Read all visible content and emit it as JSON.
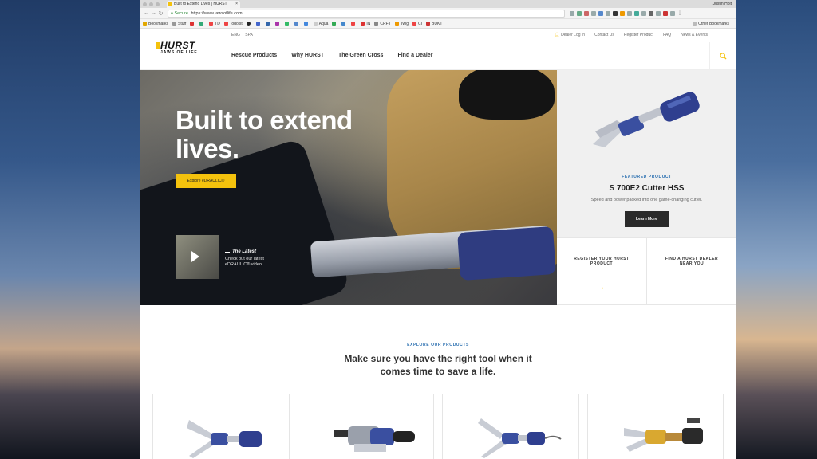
{
  "browser": {
    "tab_title": "Built to Extend Lives | HURST",
    "user": "Justin Holt",
    "secure_label": "Secure",
    "url": "https://www.jawsoflife.com",
    "bookmarks": [
      "Bookmarks",
      "Stuff",
      "TD",
      "Todoist",
      "Aqua",
      "IN",
      "CRFT",
      "Twig",
      "CI",
      "BUKT"
    ],
    "other_bookmarks": "Other Bookmarks"
  },
  "site": {
    "logo_main": "HURST",
    "logo_sub": "JAWS OF LIFE",
    "lang": [
      "ENG",
      "SPA"
    ],
    "utility": [
      "Dealer Log In",
      "Contact Us",
      "Register Product",
      "FAQ",
      "News & Events"
    ],
    "nav": [
      "Rescue Products",
      "Why HURST",
      "The Green Cross",
      "Find a Dealer"
    ]
  },
  "hero": {
    "headline": "Built to extend lives.",
    "cta": "Explore eDRAULIC®",
    "latest_title": "The Latest",
    "latest_desc": "Check out our latest eDRAULIC® video."
  },
  "featured": {
    "label": "FEATURED PRODUCT",
    "name": "S 700E2 Cutter HSS",
    "desc": "Speed and power packed into one game-changing cutter.",
    "button": "Learn More"
  },
  "links": [
    {
      "label": "REGISTER YOUR HURST PRODUCT",
      "arrow": "→"
    },
    {
      "label": "FIND A HURST DEALER NEAR YOU",
      "arrow": "→"
    }
  ],
  "explore": {
    "label": "EXPLORE OUR PRODUCTS",
    "title": "Make sure you have the right tool when it comes time to save a life."
  },
  "colors": {
    "accent": "#f4c20d",
    "blue": "#2a6fb0",
    "dark": "#2a2a2a"
  }
}
